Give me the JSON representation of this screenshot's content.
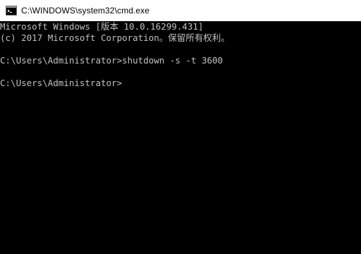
{
  "window": {
    "title": "C:\\WINDOWS\\system32\\cmd.exe",
    "icon": "cmd-icon"
  },
  "console": {
    "lines": [
      "Microsoft Windows [版本 10.0.16299.431]",
      "(c) 2017 Microsoft Corporation。保留所有权利。",
      "",
      "C:\\Users\\Administrator>shutdown -s -t 3600",
      "",
      "C:\\Users\\Administrator>"
    ],
    "text_color": "#c0c0c0",
    "background_color": "#000000"
  }
}
